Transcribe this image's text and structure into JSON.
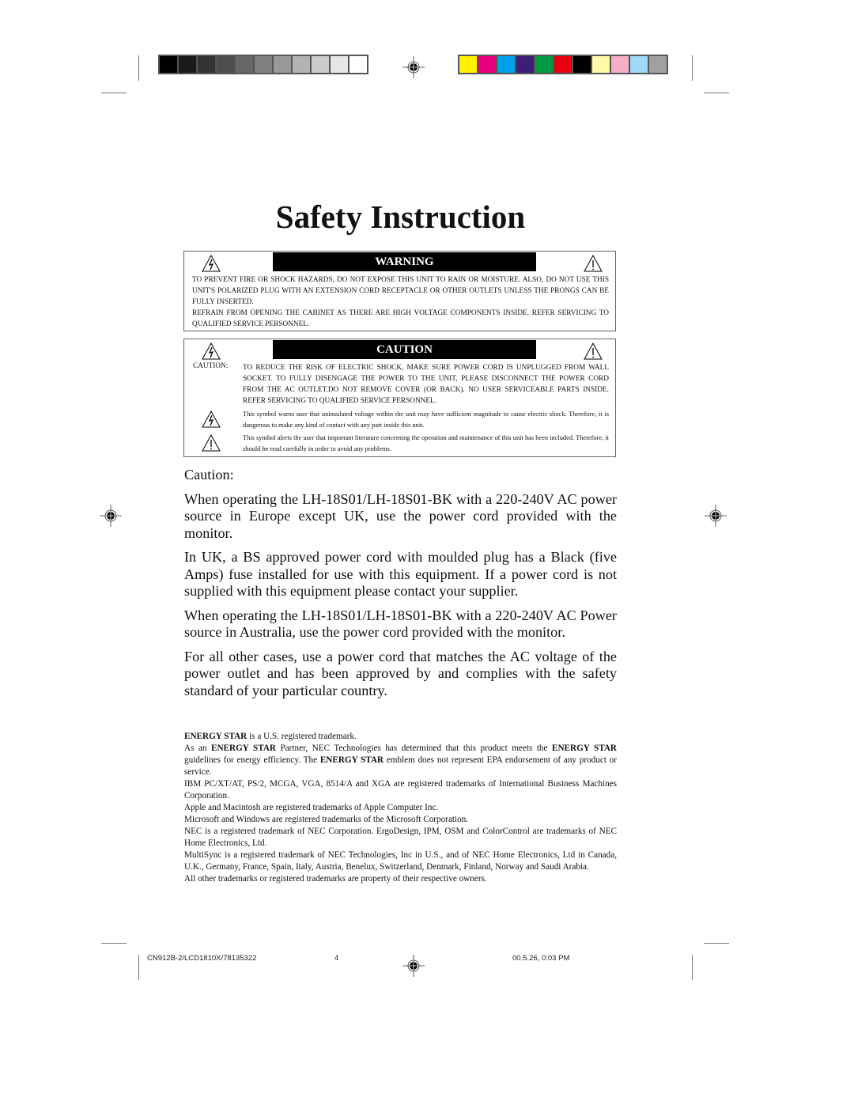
{
  "printer_marks": {
    "grayscale_swatches": [
      "#000000",
      "#1a1a1a",
      "#333333",
      "#4d4d4d",
      "#666666",
      "#808080",
      "#999999",
      "#b3b3b3",
      "#cccccc",
      "#e6e6e6",
      "#ffffff"
    ],
    "color_swatches": [
      "#fff200",
      "#e6007e",
      "#00a0e9",
      "#3e1d78",
      "#009944",
      "#e60012",
      "#000000",
      "#fff9a8",
      "#f6adc6",
      "#9fd9f6",
      "#a0a0a0"
    ]
  },
  "title": "Safety Instruction",
  "warning_box": {
    "heading": "WARNING",
    "paragraphs": [
      "TO PREVENT FIRE OR SHOCK HAZARDS, DO NOT EXPOSE THIS UNIT TO RAIN OR MOISTURE. ALSO, DO NOT USE THIS UNIT'S POLARIZED PLUG WITH AN EXTENSION CORD RECEPTACLE OR OTHER OUTLETS UNLESS THE PRONGS CAN BE FULLY INSERTED.",
      "REFRAIN FROM OPENING THE CABINET AS THERE ARE HIGH VOLTAGE COMPONENTS INSIDE. REFER SERVICING TO QUALIFIED SERVICE PERSONNEL."
    ]
  },
  "caution_box": {
    "heading": "CAUTION",
    "label": "CAUTION:",
    "text": "TO REDUCE THE RISK OF ELECTRIC SHOCK, MAKE SURE POWER CORD IS UNPLUGGED FROM WALL SOCKET. TO FULLY DISENGAGE THE POWER TO THE UNIT, PLEASE DISCONNECT THE POWER CORD FROM THE AC OUTLET.DO NOT REMOVE COVER (OR BACK). NO USER SERVICEABLE PARTS INSIDE. REFER SERVICING TO QUALIFIED SERVICE PERSONNEL.",
    "symbols": [
      {
        "icon": "electric-shock-warning-icon",
        "text": "This symbol warns user that uninsulated voltage within the unit may have sufficient magnitude to cause electric shock. Therefore, it is dangerous to make any kind of contact with any part inside this unit."
      },
      {
        "icon": "exclamation-warning-icon",
        "text": "This symbol alerts the user that important literature concerning the operation and maintenance of this unit has been included. Therefore, it should be read carefully in order to avoid any problems."
      }
    ]
  },
  "body": {
    "heading": "Caution:",
    "paragraphs": [
      "When operating the LH-18S01/LH-18S01-BK with a 220-240V AC power source in Europe except UK, use the power cord provided with the monitor.",
      "In UK, a BS approved power cord with moulded plug has a Black (five Amps) fuse installed for use with this equipment. If a power cord is not supplied with this equipment please contact your supplier.",
      "When operating the LH-18S01/LH-18S01-BK with a 220-240V AC Power source in Australia, use the power cord provided with the monitor.",
      "For all other cases, use a power cord that matches the AC voltage of the power outlet and has been approved by and complies with the safety standard of your particular country."
    ]
  },
  "trademarks": {
    "energy_star": "ENERGY STAR",
    "line1_rest": " is a U.S. registered trademark.",
    "line2_a": "As an ",
    "line2_b": " Partner, NEC Technologies has determined that this product meets the ",
    "line2_c": " guidelines for energy efficiency. The ",
    "line2_d": " emblem does not represent EPA endorsement of any product or service.",
    "others": [
      "IBM PC/XT/AT, PS/2, MCGA, VGA, 8514/A and XGA are registered trademarks of International Business Machines Corporation.",
      "Apple and Macintosh are registered trademarks of Apple Computer Inc.",
      "Microsoft and Windows are registered trademarks of the Microsoft Corporation.",
      "NEC is a registered trademark of NEC Corporation. ErgoDesign, IPM, OSM and ColorControl are trademarks of NEC Home Electronics, Ltd.",
      "MultiSync is a registered trademark of NEC Technologies, Inc in U.S., and of NEC Home Electronics, Ltd in Canada, U.K., Germany, France, Spain, Italy, Austria, Benelux, Switzerland, Denmark, Finland, Norway and Saudi Arabia.",
      "All other trademarks or registered trademarks are property of their respective owners."
    ]
  },
  "footer": {
    "file_id": "CN912B-2/LCD1810X/78135322",
    "page_number": "4",
    "timestamp": "00.5.26, 0:03 PM"
  }
}
